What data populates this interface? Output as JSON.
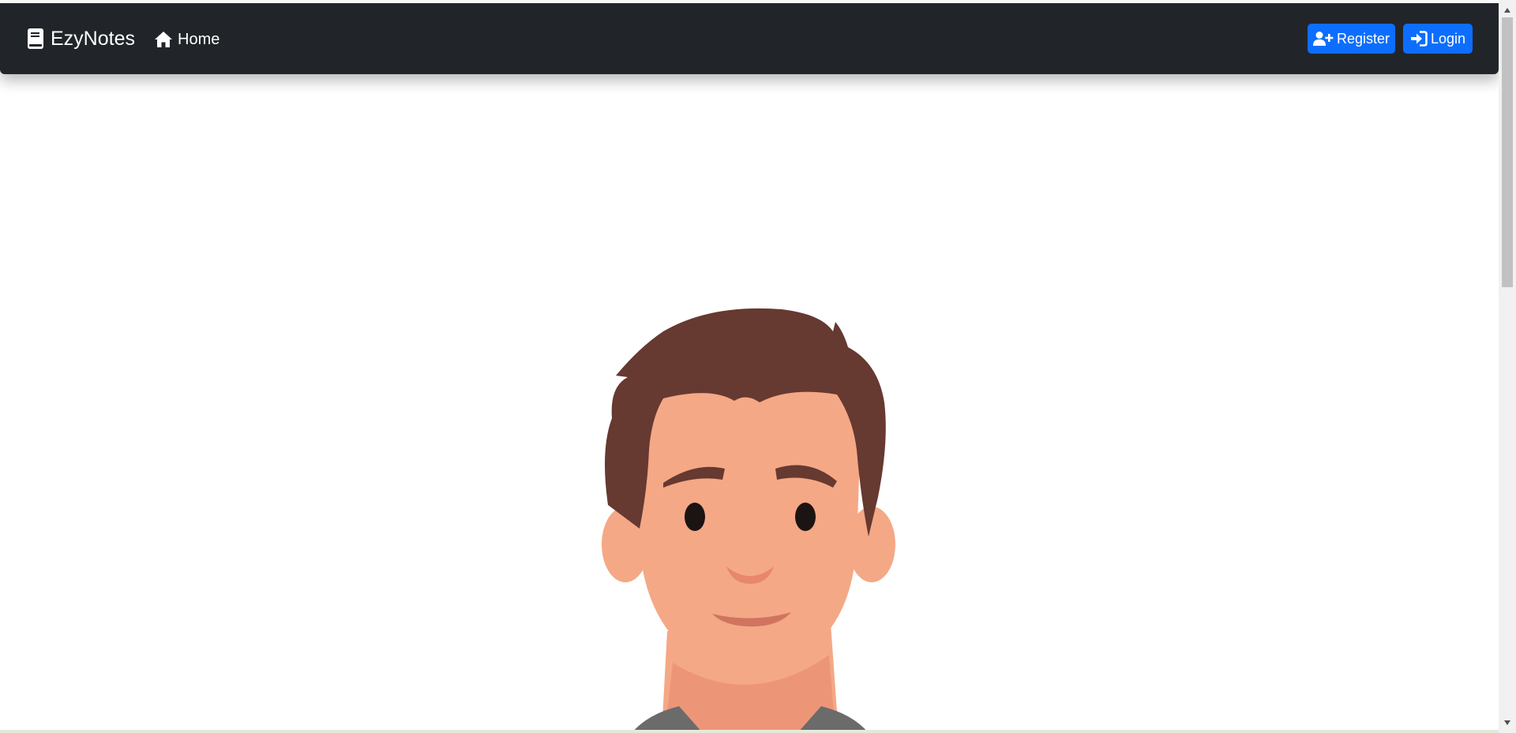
{
  "navbar": {
    "brand": {
      "label": "EzyNotes",
      "icon": "book-icon"
    },
    "home": {
      "label": "Home",
      "icon": "home-icon"
    },
    "register_button": {
      "label": "Register",
      "icon": "user-plus-icon"
    },
    "login_button": {
      "label": "Login",
      "icon": "sign-in-icon"
    }
  },
  "colors": {
    "navbar_bg": "#212529",
    "primary": "#0d6efd",
    "hair": "#663931",
    "skin": "#f4a886",
    "shirt": "#6b6b6b"
  }
}
